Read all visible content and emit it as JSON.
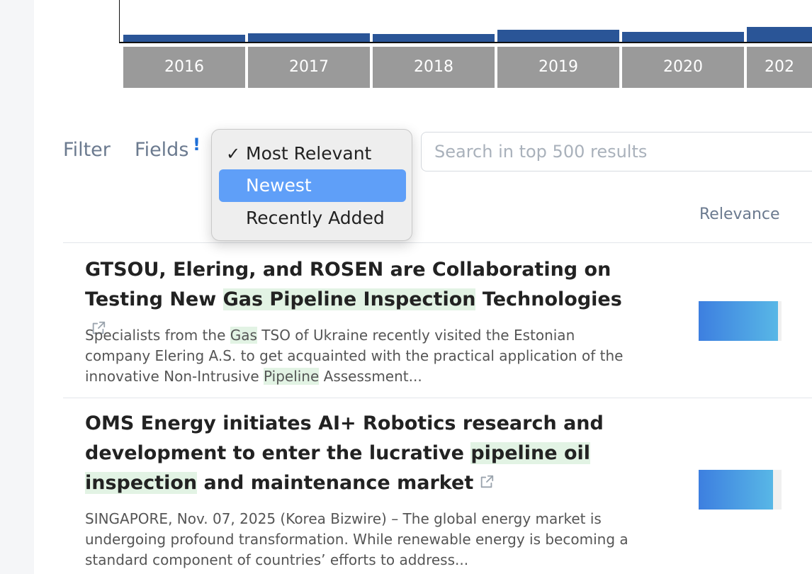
{
  "timeline": {
    "years": [
      {
        "label": "2016",
        "value": 0.45
      },
      {
        "label": "2017",
        "value": 0.55
      },
      {
        "label": "2018",
        "value": 0.5
      },
      {
        "label": "2019",
        "value": 0.75
      },
      {
        "label": "2020",
        "value": 0.65
      },
      {
        "label": "202",
        "value": 0.95
      }
    ]
  },
  "filters": {
    "filter_label": "Filter",
    "fields_label": "Fields",
    "fields_alert": "!"
  },
  "sort_dropdown": {
    "options": [
      {
        "label": "Most Relevant",
        "checked": true,
        "highlighted": false
      },
      {
        "label": "Newest",
        "checked": false,
        "highlighted": true
      },
      {
        "label": "Recently Added",
        "checked": false,
        "highlighted": false
      }
    ],
    "check_mark": "✓"
  },
  "search": {
    "placeholder": "Search in top 500 results",
    "value": ""
  },
  "results_header": {
    "relevance_label": "Relevance"
  },
  "results": [
    {
      "title_parts": [
        {
          "text": "GTSOU, Elering, and ROSEN are Collaborating on Testing New ",
          "hl": false
        },
        {
          "text": "Gas Pipeline Inspection",
          "hl": true
        },
        {
          "text": " Technologies",
          "hl": false
        }
      ],
      "snippet_parts": [
        {
          "text": "Specialists from the ",
          "hl": false
        },
        {
          "text": "Gas",
          "hl": true
        },
        {
          "text": " TSO of Ukraine recently visited the Estonian company Elering A.S. to get acquainted with the practical application of the innovative Non-Intrusive ",
          "hl": false
        },
        {
          "text": "Pipeline",
          "hl": true
        },
        {
          "text": " Assessment...",
          "hl": false
        }
      ],
      "relevance": 0.96
    },
    {
      "title_parts": [
        {
          "text": "OMS Energy initiates AI+ Robotics research and development to enter the lucrative ",
          "hl": false
        },
        {
          "text": "pipeline oil inspection",
          "hl": true
        },
        {
          "text": " and maintenance market",
          "hl": false
        }
      ],
      "snippet_parts": [
        {
          "text": "SINGAPORE, Nov. 07, 2025 (Korea Bizwire) – The global energy market is undergoing profound transformation. While renewable energy is becoming a standard component of countries’ efforts to address...",
          "hl": false
        }
      ],
      "relevance": 0.9
    }
  ],
  "colors": {
    "bar": "#2a5597",
    "highlight": "#e2f3e4",
    "dropdown_selected": "#5f9ff8"
  }
}
